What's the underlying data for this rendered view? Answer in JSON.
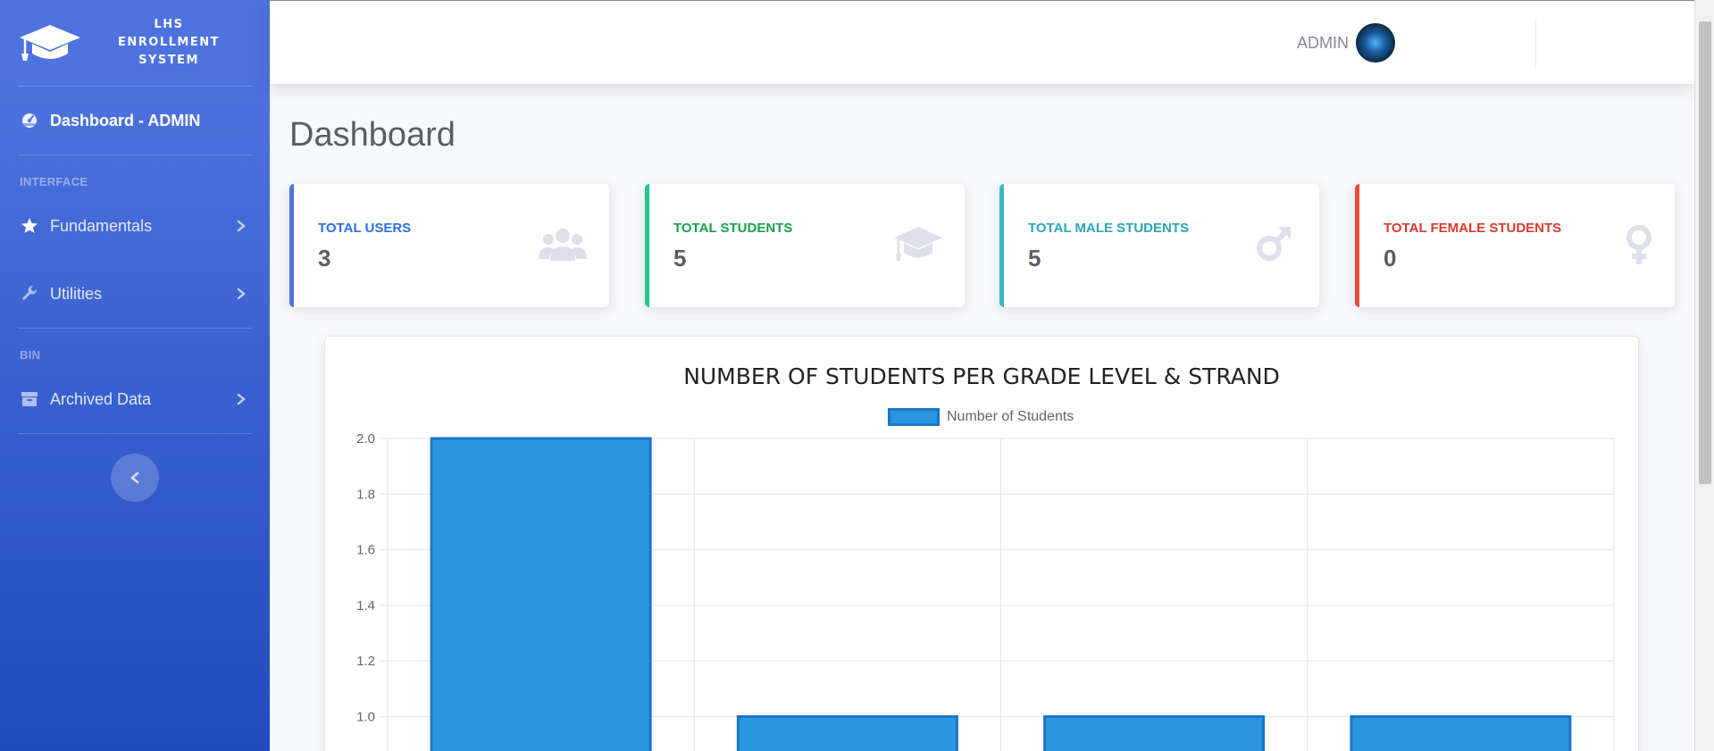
{
  "sidebar": {
    "brand": "LHS ENROLLMENT SYSTEM",
    "dashboard_label": "Dashboard - ADMIN",
    "interface_heading": "INTERFACE",
    "fundamentals_label": "Fundamentals",
    "utilities_label": "Utilities",
    "bin_heading": "BIN",
    "archived_label": "Archived Data"
  },
  "topbar": {
    "user_name": "ADMIN"
  },
  "page_title": "Dashboard",
  "cards": [
    {
      "label": "TOTAL USERS",
      "value": "3",
      "color": "#4e73df",
      "icon": "users-icon"
    },
    {
      "label": "TOTAL STUDENTS",
      "value": "5",
      "color": "#1cc88a",
      "icon": "graduation-cap-icon"
    },
    {
      "label": "TOTAL MALE STUDENTS",
      "value": "5",
      "color": "#36b9cc",
      "icon": "male-icon"
    },
    {
      "label": "TOTAL FEMALE STUDENTS",
      "value": "0",
      "color": "#e74a3b",
      "icon": "female-icon"
    }
  ],
  "colors": {
    "card_label_users": "#2f6fe0",
    "card_label_students": "#17a34a",
    "card_label_male": "#2aa6b8",
    "card_label_female": "#d63a2f",
    "bar_fill": "#2a96dd",
    "bar_border": "#1976c7"
  },
  "chart_data": {
    "type": "bar",
    "title": "NUMBER OF STUDENTS PER GRADE LEVEL & STRAND",
    "series": [
      {
        "name": "Number of Students",
        "values": [
          2,
          1,
          1,
          1
        ]
      }
    ],
    "categories": [
      "",
      "",
      "",
      ""
    ],
    "y_ticks": [
      "2.0",
      "1.8",
      "1.6",
      "1.4",
      "1.2",
      "1.0"
    ],
    "ylim": [
      0,
      2
    ],
    "legend": "top",
    "grid": true
  }
}
